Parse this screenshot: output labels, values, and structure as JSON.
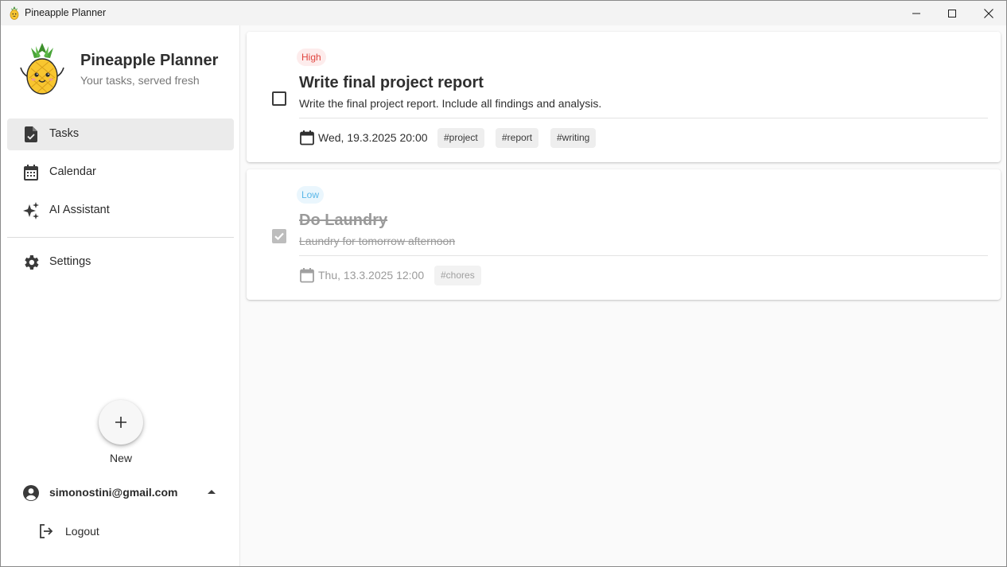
{
  "window": {
    "title": "Pineapple Planner",
    "controls": [
      "minimize-icon",
      "maximize-icon",
      "close-icon"
    ]
  },
  "sidebar": {
    "app_name": "Pineapple Planner",
    "tagline": "Your tasks, served fresh",
    "nav": [
      {
        "label": "Tasks",
        "icon": "task-icon",
        "active": true
      },
      {
        "label": "Calendar",
        "icon": "calendar-icon",
        "active": false
      },
      {
        "label": "AI Assistant",
        "icon": "sparkle-icon",
        "active": false
      }
    ],
    "settings": {
      "label": "Settings",
      "icon": "gear-icon"
    },
    "fab": {
      "label": "New",
      "icon": "plus-icon"
    },
    "user": {
      "email": "simonostini@gmail.com",
      "icon": "account-circle-icon"
    },
    "logout": {
      "label": "Logout",
      "icon": "logout-icon"
    }
  },
  "tasks": [
    {
      "priority": "High",
      "title": "Write final project report",
      "description": "Write the final project report. Include all findings and analysis.",
      "date": "Wed, 19.3.2025 20:00",
      "tags": [
        "#project",
        "#report",
        "#writing"
      ],
      "completed": false
    },
    {
      "priority": "Low",
      "title": "Do Laundry",
      "description": "Laundry for tomorrow afternoon",
      "date": "Thu, 13.3.2025 12:00",
      "tags": [
        "#chores"
      ],
      "completed": true
    }
  ],
  "colors": {
    "priority_high_text": "#e0443e",
    "priority_high_bg": "#fdecec",
    "priority_low_text": "#5ab7e8",
    "priority_low_bg": "#eaf6fd",
    "active_nav_bg": "#ebebeb"
  }
}
